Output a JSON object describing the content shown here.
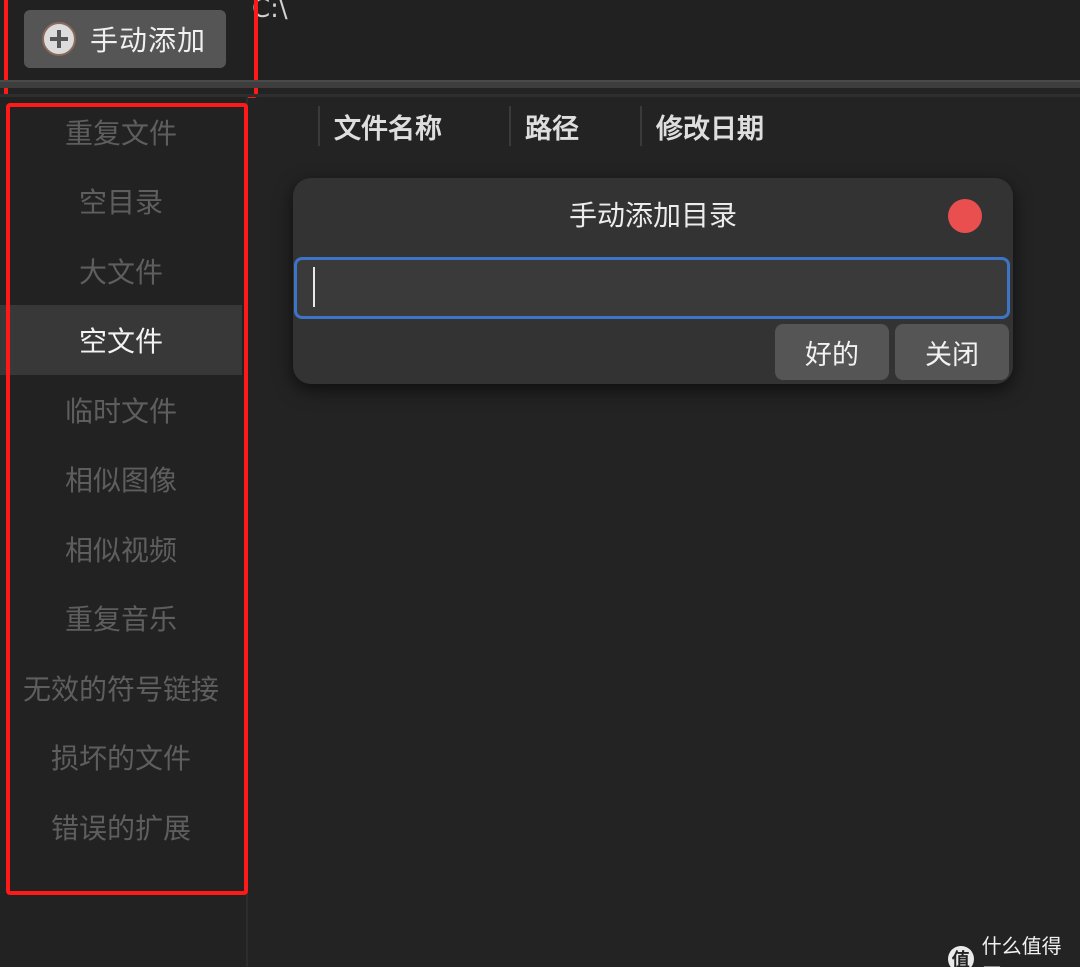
{
  "toolbar": {
    "add_button_label": "手动添加",
    "path_text": "C:\\"
  },
  "sidebar": {
    "items": [
      {
        "label": "重复文件"
      },
      {
        "label": "空目录"
      },
      {
        "label": "大文件"
      },
      {
        "label": "空文件"
      },
      {
        "label": "临时文件"
      },
      {
        "label": "相似图像"
      },
      {
        "label": "相似视频"
      },
      {
        "label": "重复音乐"
      },
      {
        "label": "无效的符号链接"
      },
      {
        "label": "损坏的文件"
      },
      {
        "label": "错误的扩展"
      }
    ],
    "active_index": 3
  },
  "table": {
    "columns": [
      "文件名称",
      "路径",
      "修改日期"
    ]
  },
  "dialog": {
    "title": "手动添加目录",
    "input_value": "",
    "ok_label": "好的",
    "close_label": "关闭"
  },
  "watermark": {
    "icon_char": "值",
    "text": "什么值得买"
  },
  "colors": {
    "background": "#232323",
    "button": "#555555",
    "input_focus_border": "#3d74c6",
    "close_dot": "#ea4f4f",
    "annotation_red": "#ff1a1a"
  }
}
